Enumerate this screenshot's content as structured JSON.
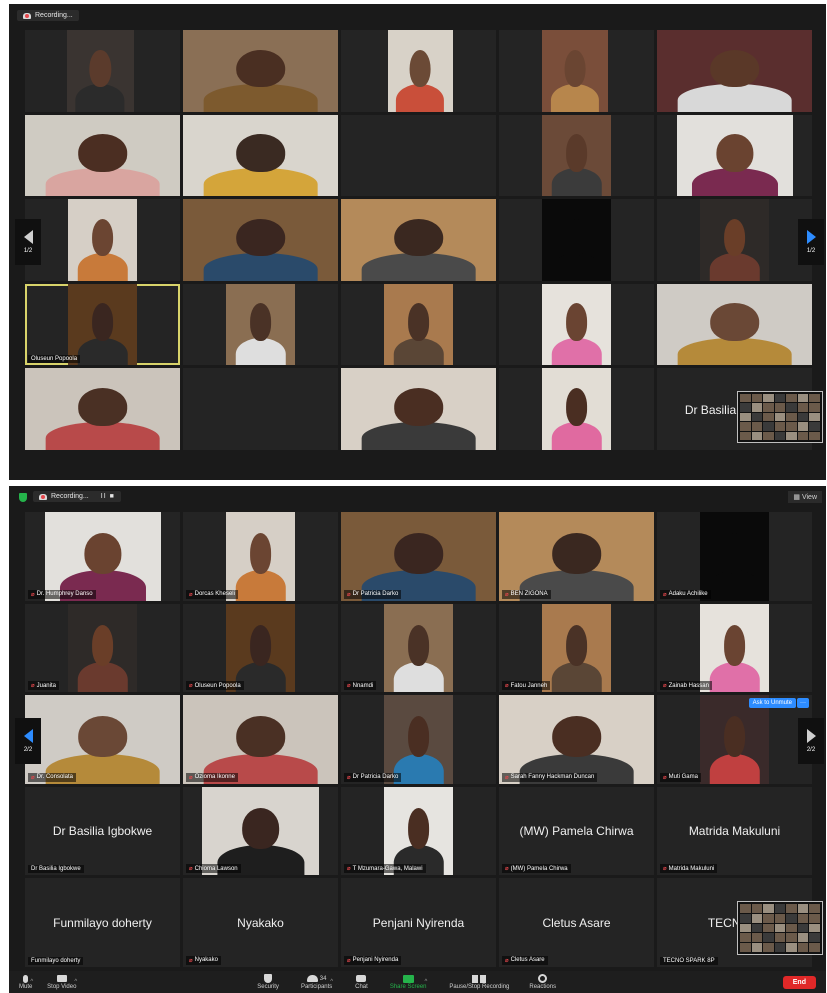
{
  "shot1": {
    "recording_label": "Recording...",
    "page_indicator_left": "1/2",
    "page_indicator_right": "1/2",
    "tiles": [
      {
        "kind": "video",
        "bg": "#3a3431",
        "skin": "#5b3b2c",
        "shirt": "#2b2b2b",
        "vl": 0.27,
        "vr": 0.7
      },
      {
        "kind": "video",
        "bg": "#8a6f55",
        "skin": "#4a2f22",
        "shirt": "#7d5a2e",
        "vl": 0.0,
        "vr": 1.0
      },
      {
        "kind": "video",
        "bg": "#d8d2c8",
        "skin": "#6b4a36",
        "shirt": "#c94f3a",
        "vl": 0.3,
        "vr": 0.72
      },
      {
        "kind": "video",
        "bg": "#7a4e3a",
        "skin": "#6a4532",
        "shirt": "#b7864c",
        "vl": 0.28,
        "vr": 0.7
      },
      {
        "kind": "video",
        "bg": "#5a2e2e",
        "skin": "#5a3828",
        "shirt": "#d8d8d8",
        "vl": 0.0,
        "vr": 1.0
      },
      {
        "kind": "video",
        "bg": "#cfcbc2",
        "skin": "#4b2e22",
        "shirt": "#d9a5a0",
        "vl": 0.0,
        "vr": 1.0
      },
      {
        "kind": "video",
        "bg": "#d9d5cd",
        "skin": "#3a2a22",
        "shirt": "#d4a53a",
        "vl": 0.0,
        "vr": 1.0
      },
      {
        "kind": "empty"
      },
      {
        "kind": "video",
        "bg": "#6b4a38",
        "skin": "#5a3a2a",
        "shirt": "#3b3b3b",
        "vl": 0.28,
        "vr": 0.72
      },
      {
        "kind": "video",
        "bg": "#e2e0dc",
        "skin": "#6a4330",
        "shirt": "#7a2a50",
        "vl": 0.13,
        "vr": 0.88
      },
      {
        "kind": "video",
        "bg": "#d6cfc6",
        "skin": "#6b4532",
        "shirt": "#c87a3a",
        "vl": 0.28,
        "vr": 0.72
      },
      {
        "kind": "video",
        "bg": "#7a5a3a",
        "skin": "#3a2620",
        "shirt": "#2a4a6a",
        "vl": 0.0,
        "vr": 1.0
      },
      {
        "kind": "video",
        "bg": "#b48a5a",
        "skin": "#3a2820",
        "shirt": "#4a4a4a",
        "vl": 0.0,
        "vr": 1.0
      },
      {
        "kind": "video",
        "bg": "#0a0a0a",
        "skin": "#0a0a0a",
        "shirt": "#0a0a0a",
        "vl": 0.28,
        "vr": 0.72
      },
      {
        "kind": "video",
        "bg": "#2e2a28",
        "skin": "#6a3e28",
        "shirt": "#6a3a2e",
        "vl": 0.28,
        "vr": 0.72
      },
      {
        "kind": "video",
        "name": "Oluseun Popoola",
        "active": true,
        "bg": "#5a3a1e",
        "skin": "#3a2620",
        "shirt": "#2a2a2a",
        "vl": 0.28,
        "vr": 0.72
      },
      {
        "kind": "video",
        "bg": "#8a6e52",
        "skin": "#4a3226",
        "shirt": "#dedede",
        "vl": 0.28,
        "vr": 0.72
      },
      {
        "kind": "video",
        "bg": "#a97a4e",
        "skin": "#4a3226",
        "shirt": "#5a4636",
        "vl": 0.28,
        "vr": 0.72
      },
      {
        "kind": "video",
        "bg": "#e6e2dc",
        "skin": "#6a4432",
        "shirt": "#e070a8",
        "vl": 0.28,
        "vr": 0.72
      },
      {
        "kind": "video",
        "bg": "#cfcbc5",
        "skin": "#6a4836",
        "shirt": "#b58a3a",
        "vl": 0.0,
        "vr": 1.0
      },
      {
        "kind": "video",
        "bg": "#cbc4bb",
        "skin": "#4a3024",
        "shirt": "#b84a4a",
        "vl": 0.0,
        "vr": 1.0
      },
      {
        "kind": "empty"
      },
      {
        "kind": "video",
        "bg": "#d8d0c6",
        "skin": "#4a2e22",
        "shirt": "#3a3a3a",
        "vl": 0.0,
        "vr": 1.0
      },
      {
        "kind": "video",
        "bg": "#e2ddd5",
        "skin": "#4a2e22",
        "shirt": "#e06aa0",
        "vl": 0.28,
        "vr": 0.72
      },
      {
        "kind": "text",
        "label": "Dr Basilia Igbokwe"
      }
    ]
  },
  "shot2": {
    "recording_label": "Recording...",
    "recording_controls": "II  ■",
    "view_label": "View",
    "page_indicator_left": "2/2",
    "page_indicator_right": "2/2",
    "ask_to_unmute": "Ask to Unmute",
    "more_label": "···",
    "tiles": [
      {
        "kind": "video",
        "name": "Dr. Humphrey Danso",
        "bg": "#e2e0dc",
        "skin": "#6a4330",
        "shirt": "#7a2a50",
        "vl": 0.13,
        "vr": 0.88
      },
      {
        "kind": "video",
        "name": "Dorcas Kheseli",
        "bg": "#d6cfc6",
        "skin": "#6b4532",
        "shirt": "#c87a3a",
        "vl": 0.28,
        "vr": 0.72
      },
      {
        "kind": "video",
        "name": "Dr Patricia Darko",
        "bg": "#7a5a3a",
        "skin": "#3a2620",
        "shirt": "#2a4a6a",
        "vl": 0.0,
        "vr": 1.0
      },
      {
        "kind": "video",
        "name": "BEN ZIGONA",
        "bg": "#b48a5a",
        "skin": "#3a2820",
        "shirt": "#4a4a4a",
        "vl": 0.0,
        "vr": 1.0
      },
      {
        "kind": "video",
        "name": "Adaku Achilike",
        "bg": "#0a0a0a",
        "skin": "#0a0a0a",
        "shirt": "#0a0a0a",
        "vl": 0.28,
        "vr": 0.72
      },
      {
        "kind": "video",
        "name": "Juanita",
        "bg": "#2e2a28",
        "skin": "#6a3e28",
        "shirt": "#6a3a2e",
        "vl": 0.28,
        "vr": 0.72
      },
      {
        "kind": "video",
        "name": "Oluseun Popoola",
        "bg": "#5a3a1e",
        "skin": "#3a2620",
        "shirt": "#2a2a2a",
        "vl": 0.28,
        "vr": 0.72
      },
      {
        "kind": "video",
        "name": "Nnamdi",
        "bg": "#8a6e52",
        "skin": "#4a3226",
        "shirt": "#dedede",
        "vl": 0.28,
        "vr": 0.72
      },
      {
        "kind": "video",
        "name": "Fatou Janneh",
        "bg": "#a97a4e",
        "skin": "#4a3226",
        "shirt": "#5a4636",
        "vl": 0.28,
        "vr": 0.72
      },
      {
        "kind": "video",
        "name": "Zainab Hassan",
        "bg": "#e6e2dc",
        "skin": "#6a4432",
        "shirt": "#e070a8",
        "vl": 0.28,
        "vr": 0.72
      },
      {
        "kind": "video",
        "name": "Dr. Consolata",
        "bg": "#cfcbc5",
        "skin": "#6a4836",
        "shirt": "#b58a3a",
        "vl": 0.0,
        "vr": 1.0
      },
      {
        "kind": "video",
        "name": "Ozioma Ikonne",
        "bg": "#cbc4bb",
        "skin": "#4a3024",
        "shirt": "#b84a4a",
        "vl": 0.0,
        "vr": 1.0
      },
      {
        "kind": "video",
        "name": "Dr Patricia Darko",
        "bg": "#5a4a40",
        "skin": "#4a2e22",
        "shirt": "#2a7ab0",
        "vl": 0.28,
        "vr": 0.72
      },
      {
        "kind": "video",
        "name": "Sarah Fanny Hackman Duncan",
        "bg": "#d8d0c6",
        "skin": "#4a2e22",
        "shirt": "#3a3a3a",
        "vl": 0.0,
        "vr": 1.0
      },
      {
        "kind": "video",
        "name": "Muti Gama",
        "unmute": true,
        "bg": "#3a2a2a",
        "skin": "#4a2e22",
        "shirt": "#c04040",
        "vl": 0.28,
        "vr": 0.72
      },
      {
        "kind": "text",
        "label": "Dr Basilia Igbokwe",
        "name": "Dr Basilia Igbokwe",
        "mic_hidden": true
      },
      {
        "kind": "video",
        "name": "Chioma Lawson",
        "bg": "#d8d4ce",
        "skin": "#3a2620",
        "shirt": "#1e1e1e",
        "vl": 0.12,
        "vr": 0.88
      },
      {
        "kind": "video",
        "name": "T Mzumara-Gawa, Malawi",
        "bg": "#e6e4e0",
        "skin": "#4a2e22",
        "shirt": "#2a2a2a",
        "vl": 0.28,
        "vr": 0.72
      },
      {
        "kind": "text",
        "label": "(MW) Pamela Chirwa",
        "name": "(MW) Pamela Chirwa"
      },
      {
        "kind": "text",
        "label": "Matrida Makuluni",
        "name": "Matrida Makuluni"
      },
      {
        "kind": "text",
        "label": "Funmilayo doherty",
        "name": "Funmilayo doherty",
        "mic_hidden": true
      },
      {
        "kind": "text",
        "label": "Nyakako",
        "name": "Nyakako"
      },
      {
        "kind": "text",
        "label": "Penjani Nyirenda",
        "name": "Penjani Nyirenda"
      },
      {
        "kind": "text",
        "label": "Cletus Asare",
        "name": "Cletus Asare"
      },
      {
        "kind": "text",
        "label": "TECNO S",
        "name": "TECNO SPARK 8P",
        "mic_hidden": true
      }
    ],
    "toolbar": {
      "mute": "Mute",
      "stop_video": "Stop Video",
      "security": "Security",
      "participants": "Participants",
      "participants_count": "34",
      "chat": "Chat",
      "share_screen": "Share Screen",
      "pause_stop_recording": "Pause/Stop Recording",
      "reactions": "Reactions",
      "end": "End"
    }
  },
  "colors": {
    "zoom_blue": "#2d8cff",
    "end_red": "#e02828",
    "share_green": "#25b34b",
    "active_speaker": "#d8d36a"
  }
}
